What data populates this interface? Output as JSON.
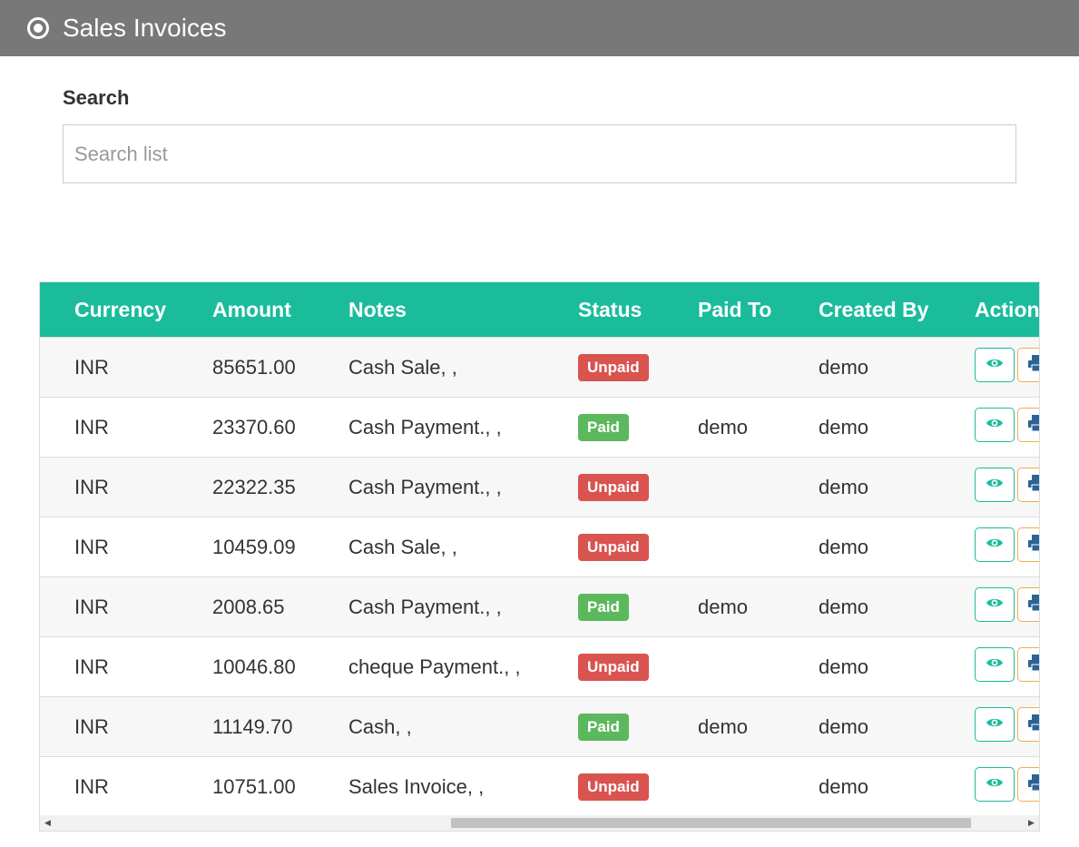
{
  "header": {
    "title": "Sales Invoices",
    "icon": "radio-target-icon"
  },
  "search": {
    "label": "Search",
    "placeholder": "Search list",
    "value": ""
  },
  "table": {
    "columns": [
      "Currency",
      "Amount",
      "Notes",
      "Status",
      "Paid To",
      "Created By",
      "Action"
    ],
    "rows": [
      {
        "currency": "INR",
        "amount": "85651.00",
        "notes": "Cash Sale, ,",
        "status": "Unpaid",
        "paid_to": "",
        "created_by": "demo"
      },
      {
        "currency": "INR",
        "amount": "23370.60",
        "notes": "Cash Payment., ,",
        "status": "Paid",
        "paid_to": "demo",
        "created_by": "demo"
      },
      {
        "currency": "INR",
        "amount": "22322.35",
        "notes": "Cash Payment., ,",
        "status": "Unpaid",
        "paid_to": "",
        "created_by": "demo"
      },
      {
        "currency": "INR",
        "amount": "10459.09",
        "notes": "Cash Sale, ,",
        "status": "Unpaid",
        "paid_to": "",
        "created_by": "demo"
      },
      {
        "currency": "INR",
        "amount": "2008.65",
        "notes": "Cash Payment., ,",
        "status": "Paid",
        "paid_to": "demo",
        "created_by": "demo"
      },
      {
        "currency": "INR",
        "amount": "10046.80",
        "notes": "cheque Payment., ,",
        "status": "Unpaid",
        "paid_to": "",
        "created_by": "demo"
      },
      {
        "currency": "INR",
        "amount": "11149.70",
        "notes": "Cash, ,",
        "status": "Paid",
        "paid_to": "demo",
        "created_by": "demo"
      },
      {
        "currency": "INR",
        "amount": "10751.00",
        "notes": "Sales Invoice, ,",
        "status": "Unpaid",
        "paid_to": "",
        "created_by": "demo"
      }
    ],
    "actions": [
      "eye-icon",
      "print-icon"
    ]
  },
  "colors": {
    "header_bg": "#787878",
    "table_header_bg": "#1abc9c",
    "unpaid": "#d9534f",
    "paid": "#5cb85c",
    "view_button_border": "#1abc9c",
    "print_button_border": "#f0ad4e"
  }
}
